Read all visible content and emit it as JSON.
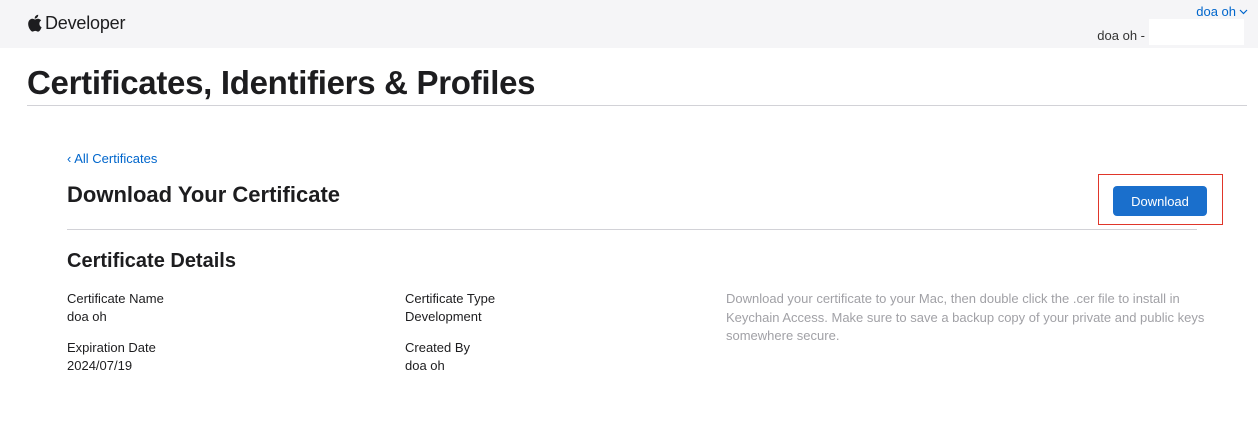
{
  "topbar": {
    "brand": "Developer",
    "user_menu_label": "doa oh",
    "team_name": "doa oh -"
  },
  "page": {
    "title": "Certificates, Identifiers & Profiles"
  },
  "back_link": "All Certificates",
  "section": {
    "title": "Download Your Certificate",
    "download_label": "Download"
  },
  "details": {
    "title": "Certificate Details",
    "fields": [
      {
        "label": "Certificate Name",
        "value": "doa oh"
      },
      {
        "label": "Certificate Type",
        "value": "Development"
      },
      {
        "label": "Expiration Date",
        "value": "2024/07/19"
      },
      {
        "label": "Created By",
        "value": "doa oh"
      }
    ],
    "help": "Download your certificate to your Mac, then double click the .cer file to install in Keychain Access. Make sure to save a backup copy of your private and public keys somewhere secure."
  },
  "colors": {
    "link": "#0066cc",
    "button": "#1a6fcc",
    "highlight": "#e0362a",
    "topbar_bg": "#f5f5f7"
  },
  "icons": {
    "brand": "apple-logo-icon",
    "user_menu": "chevron-down-icon",
    "back": "chevron-left-icon"
  }
}
